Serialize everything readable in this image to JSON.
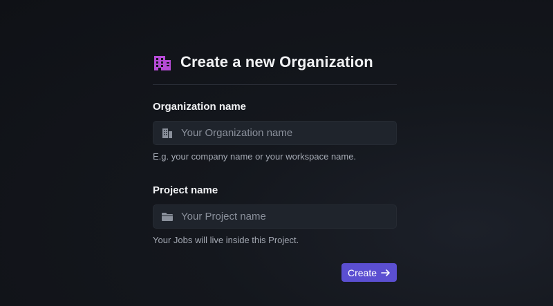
{
  "form": {
    "title": "Create a new Organization",
    "title_icon": "building-icon",
    "org_field": {
      "label": "Organization name",
      "placeholder": "Your Organization name",
      "value": "",
      "icon": "building-small-icon",
      "help": "E.g. your company name or your workspace name."
    },
    "project_field": {
      "label": "Project name",
      "placeholder": "Your Project name",
      "value": "",
      "icon": "folder-icon",
      "help": "Your Jobs will live inside this Project."
    },
    "create_button": {
      "label": "Create",
      "icon": "arrow-right-icon"
    }
  },
  "colors": {
    "background": "#121419",
    "accent": "#5b4fd1",
    "title_icon": "#b64bd6",
    "input_bg": "#1f242c"
  }
}
